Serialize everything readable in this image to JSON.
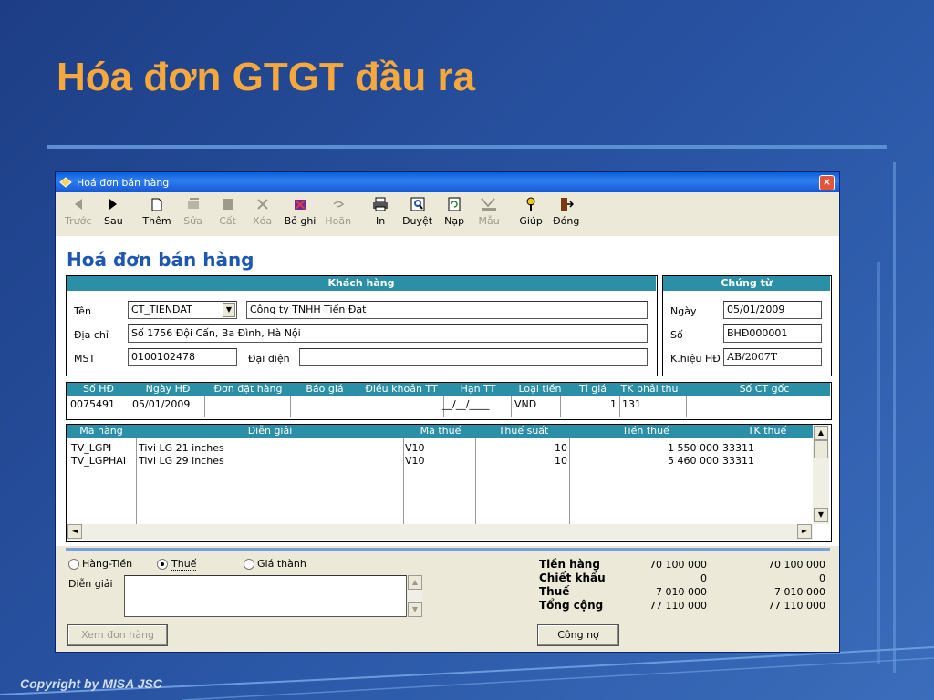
{
  "slide": {
    "title": "Hóa đơn GTGT đầu ra",
    "copyright": "Copyright by MISA JSC"
  },
  "window": {
    "title": "Hoá đơn bán hàng",
    "close_label": "×"
  },
  "toolbar": [
    {
      "label": "Trước",
      "icon": "arrow-left-icon",
      "enabled": false
    },
    {
      "label": "Sau",
      "icon": "arrow-right-icon",
      "enabled": true
    },
    {
      "label": "Thêm",
      "icon": "new-document-icon",
      "enabled": true
    },
    {
      "label": "Sửa",
      "icon": "edit-icon",
      "enabled": false
    },
    {
      "label": "Cất",
      "icon": "save-icon",
      "enabled": false
    },
    {
      "label": "Xóa",
      "icon": "delete-icon",
      "enabled": false
    },
    {
      "label": "Bỏ ghi",
      "icon": "unpost-icon",
      "enabled": true
    },
    {
      "label": "Hoãn",
      "icon": "undo-icon",
      "enabled": false
    },
    {
      "label": "In",
      "icon": "printer-icon",
      "enabled": true
    },
    {
      "label": "Duyệt",
      "icon": "preview-icon",
      "enabled": true
    },
    {
      "label": "Nạp",
      "icon": "reload-icon",
      "enabled": true
    },
    {
      "label": "Mẫu",
      "icon": "template-icon",
      "enabled": false
    },
    {
      "label": "Giúp",
      "icon": "help-icon",
      "enabled": true
    },
    {
      "label": "Đóng",
      "icon": "exit-icon",
      "enabled": true
    }
  ],
  "form_title": "Hoá đơn bán hàng",
  "customer": {
    "header": "Khách hàng",
    "name_label": "Tên",
    "code": "CT_TIENDAT",
    "company": "Công ty TNHH Tiến Đạt",
    "address_label": "Địa chỉ",
    "address": "Số 1756 Đội Cấn, Ba Đình, Hà Nội",
    "tax_label": "MST",
    "tax_code": "0100102478",
    "rep_label": "Đại diện",
    "rep": ""
  },
  "voucher": {
    "header": "Chứng từ",
    "date_label": "Ngày",
    "date": "05/01/2009",
    "no_label": "Số",
    "no": "BHĐ000001",
    "symbol_label": "K.hiệu HĐ",
    "symbol": "AB/2007T"
  },
  "invoice_grid": {
    "headers": [
      "Số HĐ",
      "Ngày HĐ",
      "Đơn đặt hàng",
      "Báo giá",
      "Điều khoản TT",
      "Hạn TT",
      "Loại tiền",
      "Tỉ giá",
      "TK phải thu",
      "Số CT gốc"
    ],
    "row": [
      "0075491",
      "05/01/2009",
      "",
      "",
      "",
      "__/__/____",
      "VND",
      "1",
      "131",
      ""
    ]
  },
  "item_grid": {
    "headers": [
      "Mã hàng",
      "Diễn giải",
      "Mã thuế",
      "Thuế suất",
      "Tiền thuế",
      "TK thuế"
    ],
    "rows": [
      [
        "TV_LGPI",
        "Tivi LG 21 inches",
        "V10",
        "10",
        "1 550 000",
        "33311"
      ],
      [
        "TV_LGPHAI",
        "Tivi LG 29 inches",
        "V10",
        "10",
        "5 460 000",
        "33311"
      ]
    ]
  },
  "options": {
    "hang_tien": "Hàng-Tiền",
    "thue": "Thuế",
    "gia_thanh": "Giá thành",
    "selected": "thue",
    "dien_giai_label": "Diễn giải",
    "dien_giai": ""
  },
  "buttons": {
    "view_order": "Xem đơn hàng",
    "debt": "Công nợ"
  },
  "totals": {
    "rows": [
      {
        "label": "Tiền hàng",
        "v1": "70 100 000",
        "v2": "70 100 000"
      },
      {
        "label": "Chiết khấu",
        "v1": "0",
        "v2": "0"
      },
      {
        "label": "Thuế",
        "v1": "7 010 000",
        "v2": "7 010 000"
      },
      {
        "label": "Tổng cộng",
        "v1": "77 110 000",
        "v2": "77 110 000"
      }
    ]
  }
}
